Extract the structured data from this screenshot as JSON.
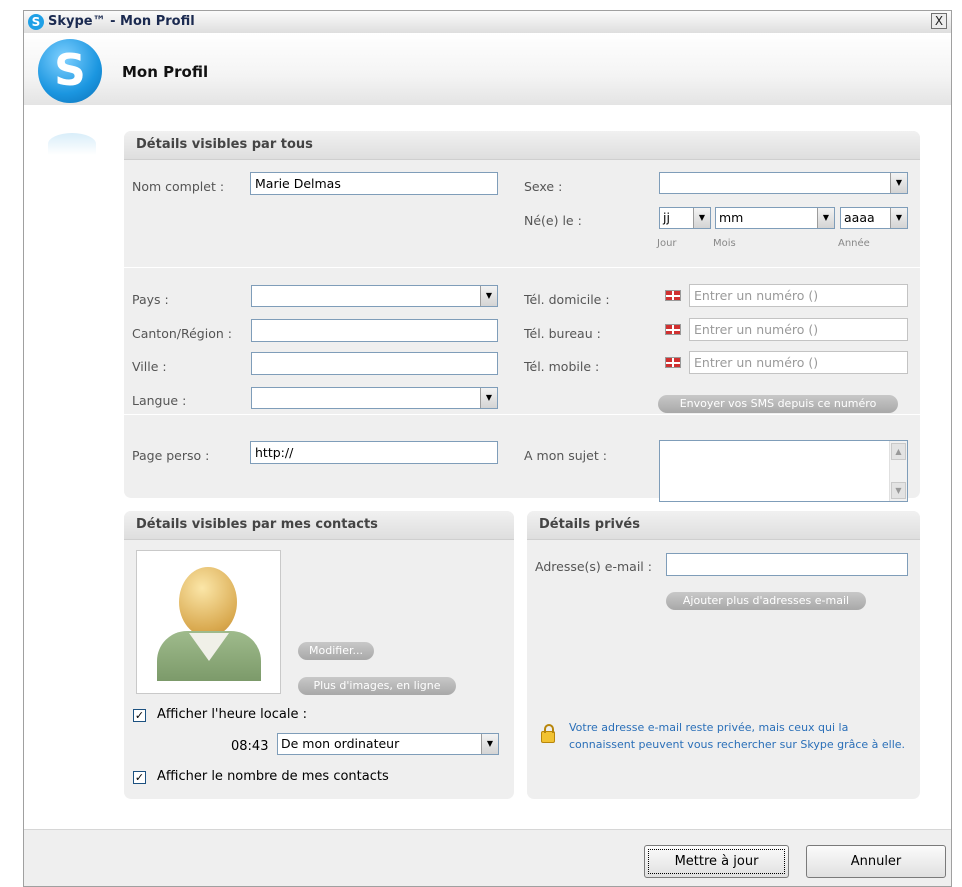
{
  "window": {
    "title": "Skype™ - Mon Profil",
    "close_label": "X"
  },
  "header": {
    "title": "Mon Profil"
  },
  "public_section": {
    "title": "Détails visibles par tous",
    "full_name_label": "Nom complet :",
    "full_name_value": "Marie Delmas",
    "sex_label": "Sexe :",
    "sex_value": "",
    "birth_label": "Né(e) le :",
    "birth_day_value": "jj",
    "birth_month_value": "mm",
    "birth_year_value": "aaaa",
    "day_caption": "Jour",
    "month_caption": "Mois",
    "year_caption": "Année",
    "country_label": "Pays :",
    "country_value": "",
    "region_label": "Canton/Région :",
    "region_value": "",
    "city_label": "Ville :",
    "city_value": "",
    "language_label": "Langue :",
    "language_value": "",
    "home_phone_label": "Tél. domicile :",
    "office_phone_label": "Tél. bureau :",
    "mobile_phone_label": "Tél. mobile :",
    "phone_placeholder": "Entrer un numéro ()",
    "sms_button": "Envoyer vos SMS depuis ce numéro",
    "homepage_label": "Page perso :",
    "homepage_value": "http://",
    "about_label": "A mon sujet :"
  },
  "contacts_section": {
    "title": "Détails visibles par mes contacts",
    "modify_button": "Modifier...",
    "more_images_button": "Plus d'images, en ligne",
    "show_local_time_label": "Afficher l'heure locale :",
    "show_local_time_checked": true,
    "time_value": "08:43",
    "time_source_value": "De mon ordinateur",
    "show_contacts_count_label": "Afficher le nombre de mes contacts",
    "show_contacts_count_checked": true
  },
  "private_section": {
    "title": "Détails privés",
    "email_label": "Adresse(s) e-mail :",
    "email_value": "",
    "add_email_button": "Ajouter plus d'adresses e-mail",
    "privacy_note": "Votre adresse e-mail reste privée, mais ceux qui la connaissent peuvent vous rechercher sur Skype grâce à elle."
  },
  "footer": {
    "update_button": "Mettre à jour",
    "cancel_button": "Annuler"
  }
}
